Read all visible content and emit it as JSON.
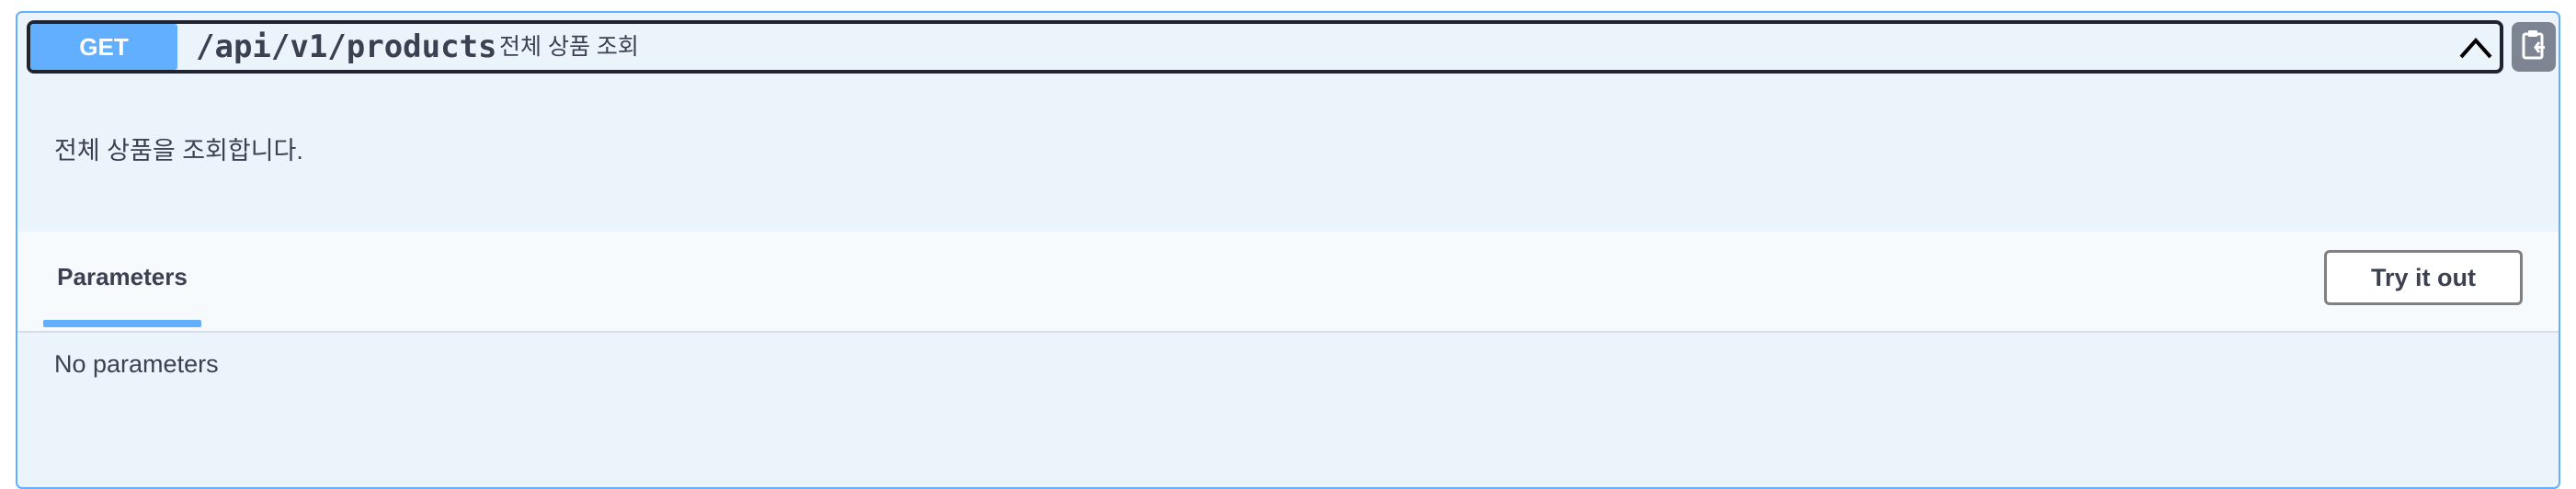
{
  "endpoint": {
    "method": "GET",
    "path": "/api/v1/products",
    "summary": "전체 상품 조회",
    "description": "전체 상품을 조회합니다."
  },
  "icons": {
    "collapse": "chevron-up-icon",
    "copy": "clipboard-copy-icon"
  },
  "parameters": {
    "tab_label": "Parameters",
    "try_button_label": "Try it out",
    "empty_text": "No parameters"
  },
  "colors": {
    "method_get": "#61affe",
    "block_background": "#ebf3fb",
    "text": "#3b4151"
  }
}
